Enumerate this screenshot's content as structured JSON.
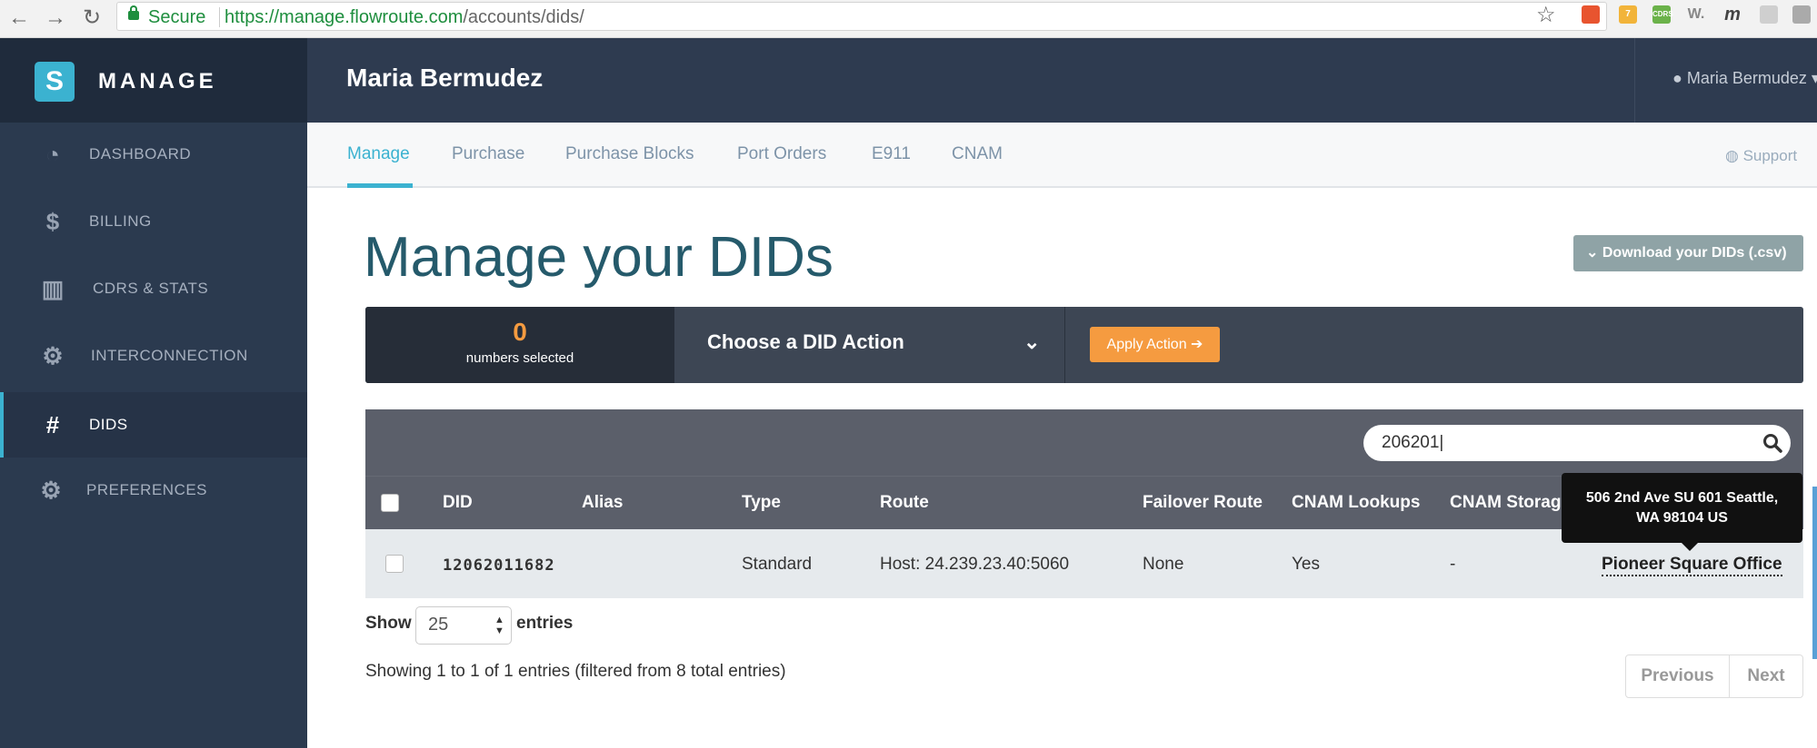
{
  "browser": {
    "secure_label": "Secure",
    "url_host": "https://manage.flowroute.com",
    "url_path": "/accounts/dids/",
    "back_icon": "←",
    "forward_icon": "→",
    "reload_icon": "↻",
    "star_icon": "☆",
    "ext_badge": "7",
    "ext_cdrs": "CDRS",
    "ext_w": "W.",
    "ext_m": "m"
  },
  "brand": {
    "name": "MANAGE",
    "logo": "S"
  },
  "sidebar": {
    "items": [
      {
        "label": "DASHBOARD",
        "icon": "◔"
      },
      {
        "label": "BILLING",
        "icon": "$"
      },
      {
        "label": "CDRS & STATS",
        "icon": "▥"
      },
      {
        "label": "INTERCONNECTION",
        "icon": "⚙"
      },
      {
        "label": "DIDS",
        "icon": "#"
      },
      {
        "label": "PREFERENCES",
        "icon": "⚙"
      }
    ]
  },
  "header": {
    "title": "Maria Bermudez",
    "user_menu": "Maria Bermudez ▾"
  },
  "tabs": {
    "items": [
      "Manage",
      "Purchase",
      "Purchase Blocks",
      "Port Orders",
      "E911",
      "CNAM"
    ],
    "support": "Support"
  },
  "page": {
    "title": "Manage your DIDs",
    "download_label": "Download your DIDs (.csv)"
  },
  "actions": {
    "selected_count": "0",
    "selected_label": "numbers selected",
    "choose_label": "Choose a DID Action",
    "apply_label": "Apply Action ➔"
  },
  "search": {
    "value": "206201|"
  },
  "table": {
    "headers": [
      "DID",
      "Alias",
      "Type",
      "Route",
      "Failover Route",
      "CNAM Lookups",
      "CNAM Storag"
    ],
    "rows": [
      {
        "did": "12062011682",
        "alias": "",
        "type": "Standard",
        "route": "Host: 24.239.23.40:5060",
        "failover": "None",
        "cnam_lookups": "Yes",
        "cnam_storage": "-",
        "e911": "Pioneer Square Office"
      }
    ]
  },
  "tooltip": {
    "line1": "506 2nd Ave SU 601 Seattle,",
    "line2": "WA 98104 US"
  },
  "pagination": {
    "show_label": "Show",
    "page_size": "25",
    "entries_label": "entries",
    "info": "Showing 1 to 1 of 1 entries (filtered from 8 total entries)",
    "previous": "Previous",
    "next": "Next"
  },
  "colors": {
    "accent": "#3bb2d0",
    "sidebar_bg": "#2b3a4f",
    "action_orange": "#f59b40",
    "title_teal": "#255a6b"
  }
}
